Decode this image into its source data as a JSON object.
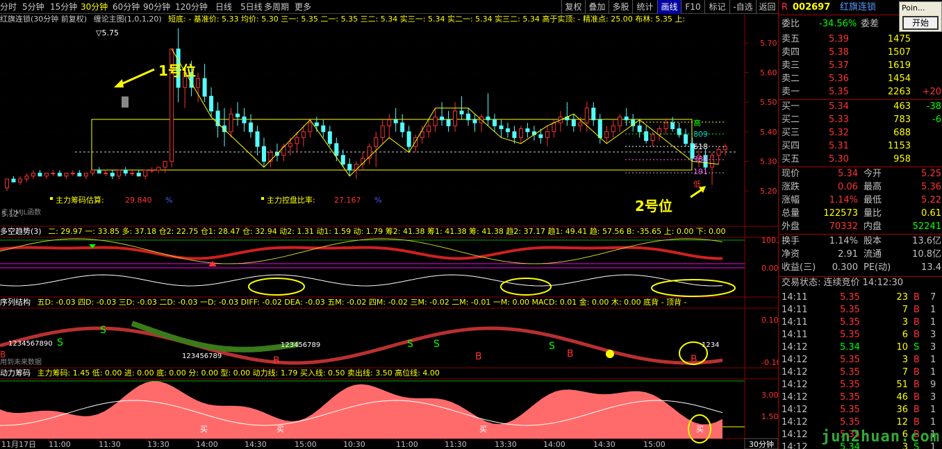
{
  "toolbar": {
    "periods": [
      "分时",
      "5分钟",
      "15分钟",
      "30分钟",
      "60分钟",
      "90分钟",
      "120分钟",
      "日线",
      "5日线",
      "多周期",
      "更多"
    ],
    "active_period": "30分钟",
    "right_buttons": [
      "复权",
      "叠加",
      "多股",
      "统计",
      "画线",
      "F10",
      "标记",
      "-自选",
      "返回"
    ],
    "selected_right": "画线"
  },
  "main_header": {
    "stock": "红旗连锁(30分钟 前复权)",
    "indicator": "缠论主图(1,0,1,20)",
    "line1": "短底: - 基准价: 5.33 均价: 5.30 三一: 5.35 二一: 5.35 三二: 5.34 实三一: 5.34 实二一: 5.34 实三二: 5.34 高于实顶: - 精准点: 25.00 布林: 5.35 上:"
  },
  "main_labels": {
    "top_price": "5.75",
    "bottom_price": "5.12",
    "main_force_est": "主力筹码估算:",
    "main_force_est_val": "29.840",
    "pct1": "%",
    "control_ratio": "主力控盘比率:",
    "control_ratio_val": "27.167",
    "pct2": "%",
    "func": "主力MJL函数",
    "right_tags": [
      "高",
      "809",
      "618",
      "382",
      "191",
      "低"
    ]
  },
  "annotations": {
    "pos1": "1号位",
    "pos2": "2号位"
  },
  "y_axis_main": [
    "5.70",
    "5.60",
    "5.50",
    "5.40",
    "5.30",
    "5.20"
  ],
  "panel2": {
    "title": "多空趋势(3)",
    "values": "二: 29.97 一: 33.85 多: 37.18 仓2: 22.75 仓1: 28.47 仓: 32.94 动2: 1.31 动1: 1.59 动: 1.79 筹2: 41.38 筹1: 41.38 筹: 41.38 趋2: 37.17 趋1: 49.41 趋: 57.56 B: -35.65 上: 0.00 下: 0.00",
    "axis": [
      "100.0",
      "0.00"
    ]
  },
  "panel3": {
    "title": "序列结构",
    "values": "五D: -0.03 四D: -0.03 三D: -0.03 二D: -0.03 一D: -0.03 DIFF: -0.02 DEA: -0.03 五M: -0.02 四M: -0.02 三M: -0.02 二M: -0.01 一M: 0.00 MACD: 0.01 金: 0.00 木: 0.00 底背 - 顶背 -",
    "axis": [
      "0.10",
      "-0.10"
    ],
    "future": "用到未来数据",
    "seq1": "1234567890",
    "seq2": "123456789",
    "seq3": "123456789",
    "seq4": "1234"
  },
  "panel4": {
    "title": "动力筹码",
    "values": "主力筹码: 1.45 低: 0.00 进: 0.00 底: 0.00 分: 0.00 型: 0.00 动力线: 1.79 买入线: 0.50 卖出线: 3.50 高位线: 4.00",
    "axis": [
      "3.00",
      "1.50"
    ],
    "buy": "买"
  },
  "x_axis": [
    "11月17日",
    "11:00",
    "11:30",
    "13:30",
    "14:00",
    "14:30",
    "15:00",
    "10:30",
    "11:00",
    "11:30",
    "13:30",
    "14:00",
    "14:30",
    "15:00"
  ],
  "period_tag": "30分钟",
  "quote": {
    "code": "002697",
    "name": "红旗连锁",
    "weibi_label": "委比",
    "weibi": "-34.56%",
    "weicha_label": "委差",
    "asks": [
      {
        "l": "卖五",
        "p": "5.39",
        "v": "1475",
        "c": ""
      },
      {
        "l": "卖四",
        "p": "5.38",
        "v": "1507",
        "c": ""
      },
      {
        "l": "卖三",
        "p": "5.37",
        "v": "1619",
        "c": ""
      },
      {
        "l": "卖二",
        "p": "5.36",
        "v": "1454",
        "c": ""
      },
      {
        "l": "卖一",
        "p": "5.35",
        "v": "2263",
        "c": "+20"
      }
    ],
    "bids": [
      {
        "l": "买一",
        "p": "5.34",
        "v": "463",
        "c": "-38"
      },
      {
        "l": "买二",
        "p": "5.33",
        "v": "783",
        "c": "-6"
      },
      {
        "l": "买三",
        "p": "5.32",
        "v": "688",
        "c": ""
      },
      {
        "l": "买四",
        "p": "5.31",
        "v": "1153",
        "c": ""
      },
      {
        "l": "买五",
        "p": "5.30",
        "v": "958",
        "c": ""
      }
    ],
    "stats": [
      {
        "a": "现价",
        "b": "5.34",
        "c": "今开",
        "d": "5.25"
      },
      {
        "a": "涨跌",
        "b": "0.06",
        "c": "最高",
        "d": "5.36"
      },
      {
        "a": "涨幅",
        "b": "1.14%",
        "c": "最低",
        "d": "5.22"
      },
      {
        "a": "总量",
        "b": "122573",
        "c": "量比",
        "d": "0.61"
      },
      {
        "a": "外盘",
        "b": "70332",
        "c": "内盘",
        "d": "52241"
      }
    ],
    "stats2": [
      {
        "a": "换手",
        "b": "1.14%",
        "c": "股本",
        "d": "13.6亿"
      },
      {
        "a": "净资",
        "b": "2.91",
        "c": "流通",
        "d": "10.8亿"
      },
      {
        "a": "收益(三)",
        "b": "0.300",
        "c": "PE(动)",
        "d": "13.4"
      }
    ],
    "status": "交易状态: 连续竞价 14:12:30",
    "ticks": [
      {
        "t": "14:11",
        "p": "5.35",
        "v": "23",
        "s": "B",
        "n": "7"
      },
      {
        "t": "14:11",
        "p": "5.35",
        "v": "7",
        "s": "B",
        "n": "1"
      },
      {
        "t": "14:11",
        "p": "5.35",
        "v": "3",
        "s": "B",
        "n": "1"
      },
      {
        "t": "14:11",
        "p": "5.35",
        "v": "6",
        "s": "B",
        "n": "3"
      },
      {
        "t": "14:12",
        "p": "5.34",
        "v": "10",
        "s": "S",
        "n": "3"
      },
      {
        "t": "14:12",
        "p": "5.35",
        "v": "3",
        "s": "B",
        "n": "1"
      },
      {
        "t": "14:12",
        "p": "5.35",
        "v": "7",
        "s": "B",
        "n": "1"
      },
      {
        "t": "14:12",
        "p": "5.35",
        "v": "51",
        "s": "B",
        "n": "9"
      },
      {
        "t": "14:12",
        "p": "5.35",
        "v": "46",
        "s": "B",
        "n": "3"
      },
      {
        "t": "14:12",
        "p": "5.35",
        "v": "36",
        "s": "B",
        "n": "1"
      },
      {
        "t": "14:12",
        "p": "5.35",
        "v": "12",
        "s": "B",
        "n": "1"
      },
      {
        "t": "14:12",
        "p": "5.35",
        "v": "6",
        "s": "B",
        "n": "1"
      },
      {
        "t": "14:12",
        "p": "5.34",
        "v": "3",
        "s": "S",
        "n": "1"
      }
    ]
  },
  "popup": {
    "title": "Poin...",
    "button": "开始"
  },
  "watermark": "jun2huan.com",
  "colors": {
    "up": "#ff3232",
    "down": "#54ffff",
    "yellow": "#ffff00",
    "green": "#00d000",
    "grid": "#8b0000",
    "bg": "#000000"
  },
  "chart_data": {
    "type": "candlestick",
    "title": "红旗连锁(30分钟 前复权)",
    "ohlc": [
      [
        5.21,
        5.24,
        5.2,
        5.24
      ],
      [
        5.24,
        5.25,
        5.23,
        5.23
      ],
      [
        5.23,
        5.25,
        5.22,
        5.24
      ],
      [
        5.24,
        5.26,
        5.23,
        5.25
      ],
      [
        5.25,
        5.27,
        5.24,
        5.26
      ],
      [
        5.26,
        5.27,
        5.25,
        5.25
      ],
      [
        5.25,
        5.26,
        5.24,
        5.26
      ],
      [
        5.26,
        5.27,
        5.25,
        5.26
      ],
      [
        5.26,
        5.27,
        5.25,
        5.25
      ],
      [
        5.25,
        5.26,
        5.24,
        5.26
      ],
      [
        5.26,
        5.27,
        5.25,
        5.26
      ],
      [
        5.26,
        5.27,
        5.25,
        5.25
      ],
      [
        5.25,
        5.26,
        5.24,
        5.26
      ],
      [
        5.26,
        5.27,
        5.25,
        5.27
      ],
      [
        5.27,
        5.28,
        5.26,
        5.26
      ],
      [
        5.26,
        5.27,
        5.25,
        5.26
      ],
      [
        5.26,
        5.27,
        5.24,
        5.25
      ],
      [
        5.25,
        5.27,
        5.24,
        5.27
      ],
      [
        5.27,
        5.28,
        5.25,
        5.26
      ],
      [
        5.26,
        5.27,
        5.25,
        5.26
      ],
      [
        5.26,
        5.27,
        5.25,
        5.25
      ],
      [
        5.25,
        5.27,
        5.24,
        5.27
      ],
      [
        5.27,
        5.28,
        5.26,
        5.27
      ],
      [
        5.27,
        5.28,
        5.26,
        5.28
      ],
      [
        5.28,
        5.3,
        5.26,
        5.3
      ],
      [
        5.3,
        5.68,
        5.28,
        5.68
      ],
      [
        5.68,
        5.75,
        5.5,
        5.55
      ],
      [
        5.55,
        5.62,
        5.48,
        5.6
      ],
      [
        5.6,
        5.64,
        5.52,
        5.55
      ],
      [
        5.55,
        5.6,
        5.5,
        5.58
      ],
      [
        5.58,
        5.63,
        5.5,
        5.52
      ],
      [
        5.52,
        5.55,
        5.45,
        5.47
      ],
      [
        5.47,
        5.5,
        5.38,
        5.42
      ],
      [
        5.42,
        5.48,
        5.35,
        5.4
      ],
      [
        5.4,
        5.48,
        5.38,
        5.46
      ],
      [
        5.46,
        5.5,
        5.42,
        5.45
      ],
      [
        5.45,
        5.48,
        5.4,
        5.43
      ],
      [
        5.43,
        5.46,
        5.38,
        5.4
      ],
      [
        5.4,
        5.42,
        5.32,
        5.35
      ],
      [
        5.35,
        5.38,
        5.28,
        5.3
      ],
      [
        5.3,
        5.34,
        5.28,
        5.33
      ],
      [
        5.33,
        5.36,
        5.3,
        5.32
      ],
      [
        5.32,
        5.36,
        5.3,
        5.35
      ],
      [
        5.35,
        5.38,
        5.32,
        5.36
      ],
      [
        5.36,
        5.4,
        5.33,
        5.38
      ],
      [
        5.38,
        5.42,
        5.35,
        5.4
      ],
      [
        5.4,
        5.44,
        5.38,
        5.43
      ],
      [
        5.43,
        5.45,
        5.4,
        5.42
      ],
      [
        5.42,
        5.44,
        5.38,
        5.4
      ],
      [
        5.4,
        5.42,
        5.35,
        5.36
      ],
      [
        5.36,
        5.38,
        5.3,
        5.32
      ],
      [
        5.32,
        5.34,
        5.28,
        5.29
      ],
      [
        5.29,
        5.31,
        5.25,
        5.27
      ],
      [
        5.27,
        5.3,
        5.24,
        5.29
      ],
      [
        5.29,
        5.33,
        5.27,
        5.31
      ],
      [
        5.31,
        5.36,
        5.29,
        5.35
      ],
      [
        5.35,
        5.4,
        5.28,
        5.38
      ],
      [
        5.38,
        5.44,
        5.36,
        5.42
      ],
      [
        5.42,
        5.46,
        5.38,
        5.44
      ],
      [
        5.44,
        5.48,
        5.4,
        5.43
      ],
      [
        5.43,
        5.46,
        5.38,
        5.4
      ],
      [
        5.4,
        5.42,
        5.33,
        5.35
      ],
      [
        5.35,
        5.39,
        5.33,
        5.38
      ],
      [
        5.38,
        5.42,
        5.36,
        5.4
      ],
      [
        5.4,
        5.44,
        5.38,
        5.42
      ],
      [
        5.42,
        5.48,
        5.4,
        5.45
      ],
      [
        5.45,
        5.5,
        5.42,
        5.44
      ],
      [
        5.44,
        5.47,
        5.4,
        5.42
      ],
      [
        5.42,
        5.5,
        5.4,
        5.47
      ],
      [
        5.47,
        5.52,
        5.44,
        5.46
      ],
      [
        5.46,
        5.48,
        5.42,
        5.44
      ],
      [
        5.44,
        5.46,
        5.4,
        5.43
      ],
      [
        5.43,
        5.46,
        5.4,
        5.45
      ],
      [
        5.45,
        5.53,
        5.42,
        5.44
      ],
      [
        5.44,
        5.46,
        5.4,
        5.42
      ],
      [
        5.42,
        5.44,
        5.38,
        5.41
      ],
      [
        5.41,
        5.43,
        5.38,
        5.4
      ],
      [
        5.4,
        5.42,
        5.36,
        5.38
      ],
      [
        5.38,
        5.42,
        5.36,
        5.41
      ],
      [
        5.41,
        5.43,
        5.38,
        5.4
      ],
      [
        5.4,
        5.42,
        5.37,
        5.39
      ],
      [
        5.39,
        5.41,
        5.36,
        5.38
      ],
      [
        5.38,
        5.42,
        5.35,
        5.4
      ],
      [
        5.4,
        5.44,
        5.38,
        5.43
      ],
      [
        5.43,
        5.47,
        5.4,
        5.45
      ],
      [
        5.45,
        5.5,
        5.42,
        5.44
      ],
      [
        5.44,
        5.46,
        5.4,
        5.42
      ],
      [
        5.42,
        5.45,
        5.4,
        5.43
      ],
      [
        5.43,
        5.5,
        5.4,
        5.48
      ],
      [
        5.48,
        5.5,
        5.42,
        5.44
      ],
      [
        5.44,
        5.46,
        5.36,
        5.38
      ],
      [
        5.38,
        5.42,
        5.36,
        5.4
      ],
      [
        5.4,
        5.44,
        5.38,
        5.42
      ],
      [
        5.42,
        5.46,
        5.4,
        5.45
      ],
      [
        5.45,
        5.48,
        5.42,
        5.44
      ],
      [
        5.44,
        5.46,
        5.4,
        5.42
      ],
      [
        5.42,
        5.44,
        5.38,
        5.4
      ],
      [
        5.4,
        5.42,
        5.36,
        5.37
      ],
      [
        5.37,
        5.4,
        5.35,
        5.39
      ],
      [
        5.39,
        5.42,
        5.37,
        5.41
      ],
      [
        5.41,
        5.44,
        5.39,
        5.43
      ],
      [
        5.43,
        5.45,
        5.4,
        5.41
      ],
      [
        5.41,
        5.43,
        5.38,
        5.39
      ],
      [
        5.39,
        5.41,
        5.35,
        5.36
      ],
      [
        5.36,
        5.38,
        5.3,
        5.31
      ],
      [
        5.31,
        5.34,
        5.28,
        5.32
      ],
      [
        5.32,
        5.34,
        5.26,
        5.28
      ],
      [
        5.28,
        5.33,
        5.22,
        5.32
      ],
      [
        5.32,
        5.35,
        5.29,
        5.34
      ],
      [
        5.34,
        5.36,
        5.32,
        5.35
      ]
    ]
  }
}
